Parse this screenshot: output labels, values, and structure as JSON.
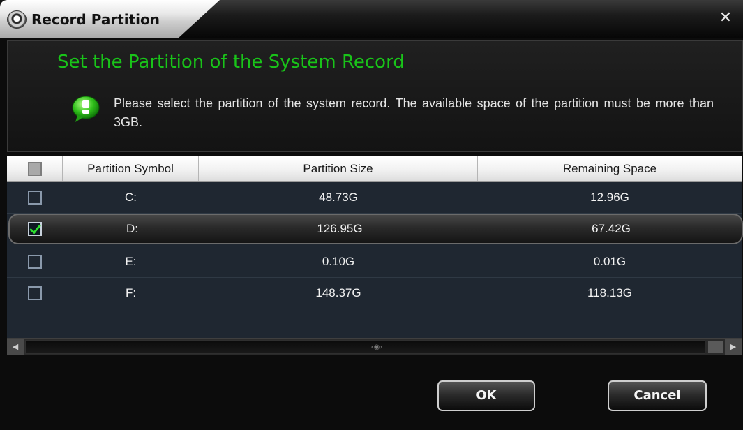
{
  "window": {
    "title": "Record Partition",
    "icon": "camera-icon",
    "close_icon": "close-icon",
    "close_glyph": "✕"
  },
  "heading": "Set the Partition of the System Record",
  "message": "Please select the partition of the system record. The available space of the partition must be more than 3GB.",
  "info_icon": "info-bubble-icon",
  "colors": {
    "heading_green": "#19c419",
    "check_green": "#2fe02f",
    "table_bg": "#1f2731"
  },
  "table": {
    "select_all_checked": false,
    "columns": [
      "Partition Symbol",
      "Partition Size",
      "Remaining Space"
    ],
    "rows": [
      {
        "symbol": "C:",
        "size": "48.73G",
        "remaining": "12.96G",
        "checked": false
      },
      {
        "symbol": "D:",
        "size": "126.95G",
        "remaining": "67.42G",
        "checked": true
      },
      {
        "symbol": "E:",
        "size": "0.10G",
        "remaining": "0.01G",
        "checked": false
      },
      {
        "symbol": "F:",
        "size": "148.37G",
        "remaining": "118.13G",
        "checked": false
      }
    ]
  },
  "scrollbar": {
    "left_glyph": "◀",
    "right_glyph": "▶",
    "grip_glyph": "‹◉›"
  },
  "buttons": {
    "ok": "OK",
    "cancel": "Cancel"
  }
}
